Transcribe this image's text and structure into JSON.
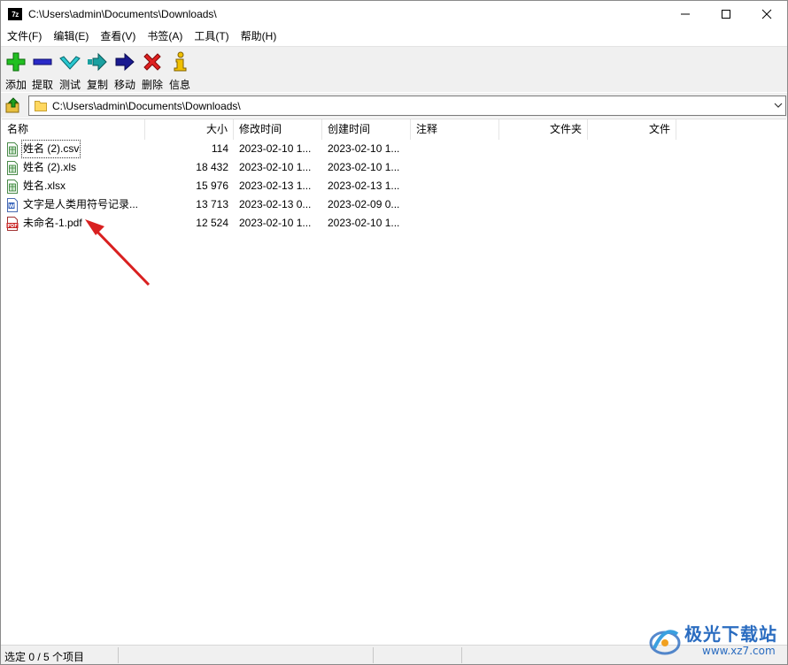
{
  "window": {
    "title": "C:\\Users\\admin\\Documents\\Downloads\\",
    "app_icon_text": "7z",
    "minimize": "—",
    "maximize": "☐",
    "close": "✕"
  },
  "menu": [
    {
      "label": "文件(F)"
    },
    {
      "label": "编辑(E)"
    },
    {
      "label": "查看(V)"
    },
    {
      "label": "书签(A)"
    },
    {
      "label": "工具(T)"
    },
    {
      "label": "帮助(H)"
    }
  ],
  "toolbar": {
    "add": "添加",
    "extract": "提取",
    "test": "测试",
    "copy": "复制",
    "move": "移动",
    "delete": "删除",
    "info": "信息"
  },
  "address": {
    "path": "C:\\Users\\admin\\Documents\\Downloads\\",
    "dropdown_icon": "chevron-down-icon"
  },
  "columns": {
    "name": "名称",
    "size": "大小",
    "modified": "修改时间",
    "created": "创建时间",
    "comment": "注释",
    "folders": "文件夹",
    "files": "文件"
  },
  "files": [
    {
      "name": "姓名 (2).csv",
      "size": "114",
      "modified": "2023-02-10 1...",
      "created": "2023-02-10 1...",
      "icon": "spreadsheet-icon"
    },
    {
      "name": "姓名 (2).xls",
      "size": "18 432",
      "modified": "2023-02-10 1...",
      "created": "2023-02-10 1...",
      "icon": "spreadsheet-icon"
    },
    {
      "name": "姓名.xlsx",
      "size": "15 976",
      "modified": "2023-02-13 1...",
      "created": "2023-02-13 1...",
      "icon": "spreadsheet-icon"
    },
    {
      "name": "文字是人类用符号记录...",
      "size": "13 713",
      "modified": "2023-02-13 0...",
      "created": "2023-02-09 0...",
      "icon": "word-document-icon"
    },
    {
      "name": "未命名-1.pdf",
      "size": "12 524",
      "modified": "2023-02-10 1...",
      "created": "2023-02-10 1...",
      "icon": "pdf-icon"
    }
  ],
  "status": {
    "selection": "选定 0 / 5 个项目"
  },
  "watermark": {
    "text": "极光下载站",
    "url": "www.xz7.com"
  },
  "colors": {
    "accent_red": "#d92020",
    "watermark_blue": "#2a6cc0",
    "toolbar_bg": "#f0f0f0"
  }
}
